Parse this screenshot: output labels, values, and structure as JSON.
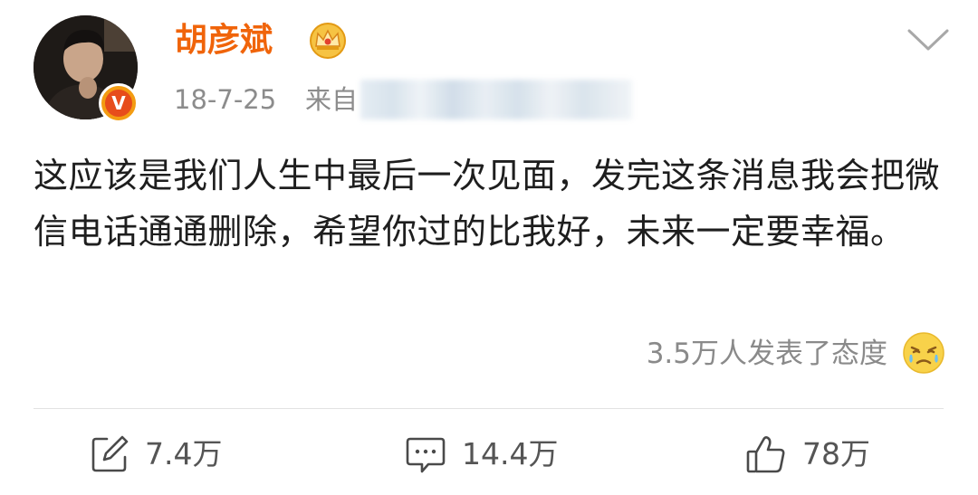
{
  "user": {
    "name": "胡彦斌"
  },
  "post": {
    "time": "18-7-25",
    "source_prefix": "来自",
    "content": "这应该是我们人生中最后一次见面，发完这条消息我会把微信电话通通删除，希望你过的比我好，未来一定要幸福。",
    "reactions_text": "3.5万人发表了态度"
  },
  "actions": {
    "repost_count": "7.4万",
    "comment_count": "14.4万",
    "like_count": "78万"
  },
  "icons": {
    "crown": "crown-icon",
    "verified": "verified-v-icon",
    "chevron": "chevron-down-icon",
    "reaction": "crying-face-emoji",
    "repost": "repost-icon",
    "comment": "comment-icon",
    "like": "thumbs-up-icon"
  },
  "colors": {
    "username": "#f0640a",
    "meta_text": "#8c8c8c",
    "verified_badge": "#f39c12"
  }
}
